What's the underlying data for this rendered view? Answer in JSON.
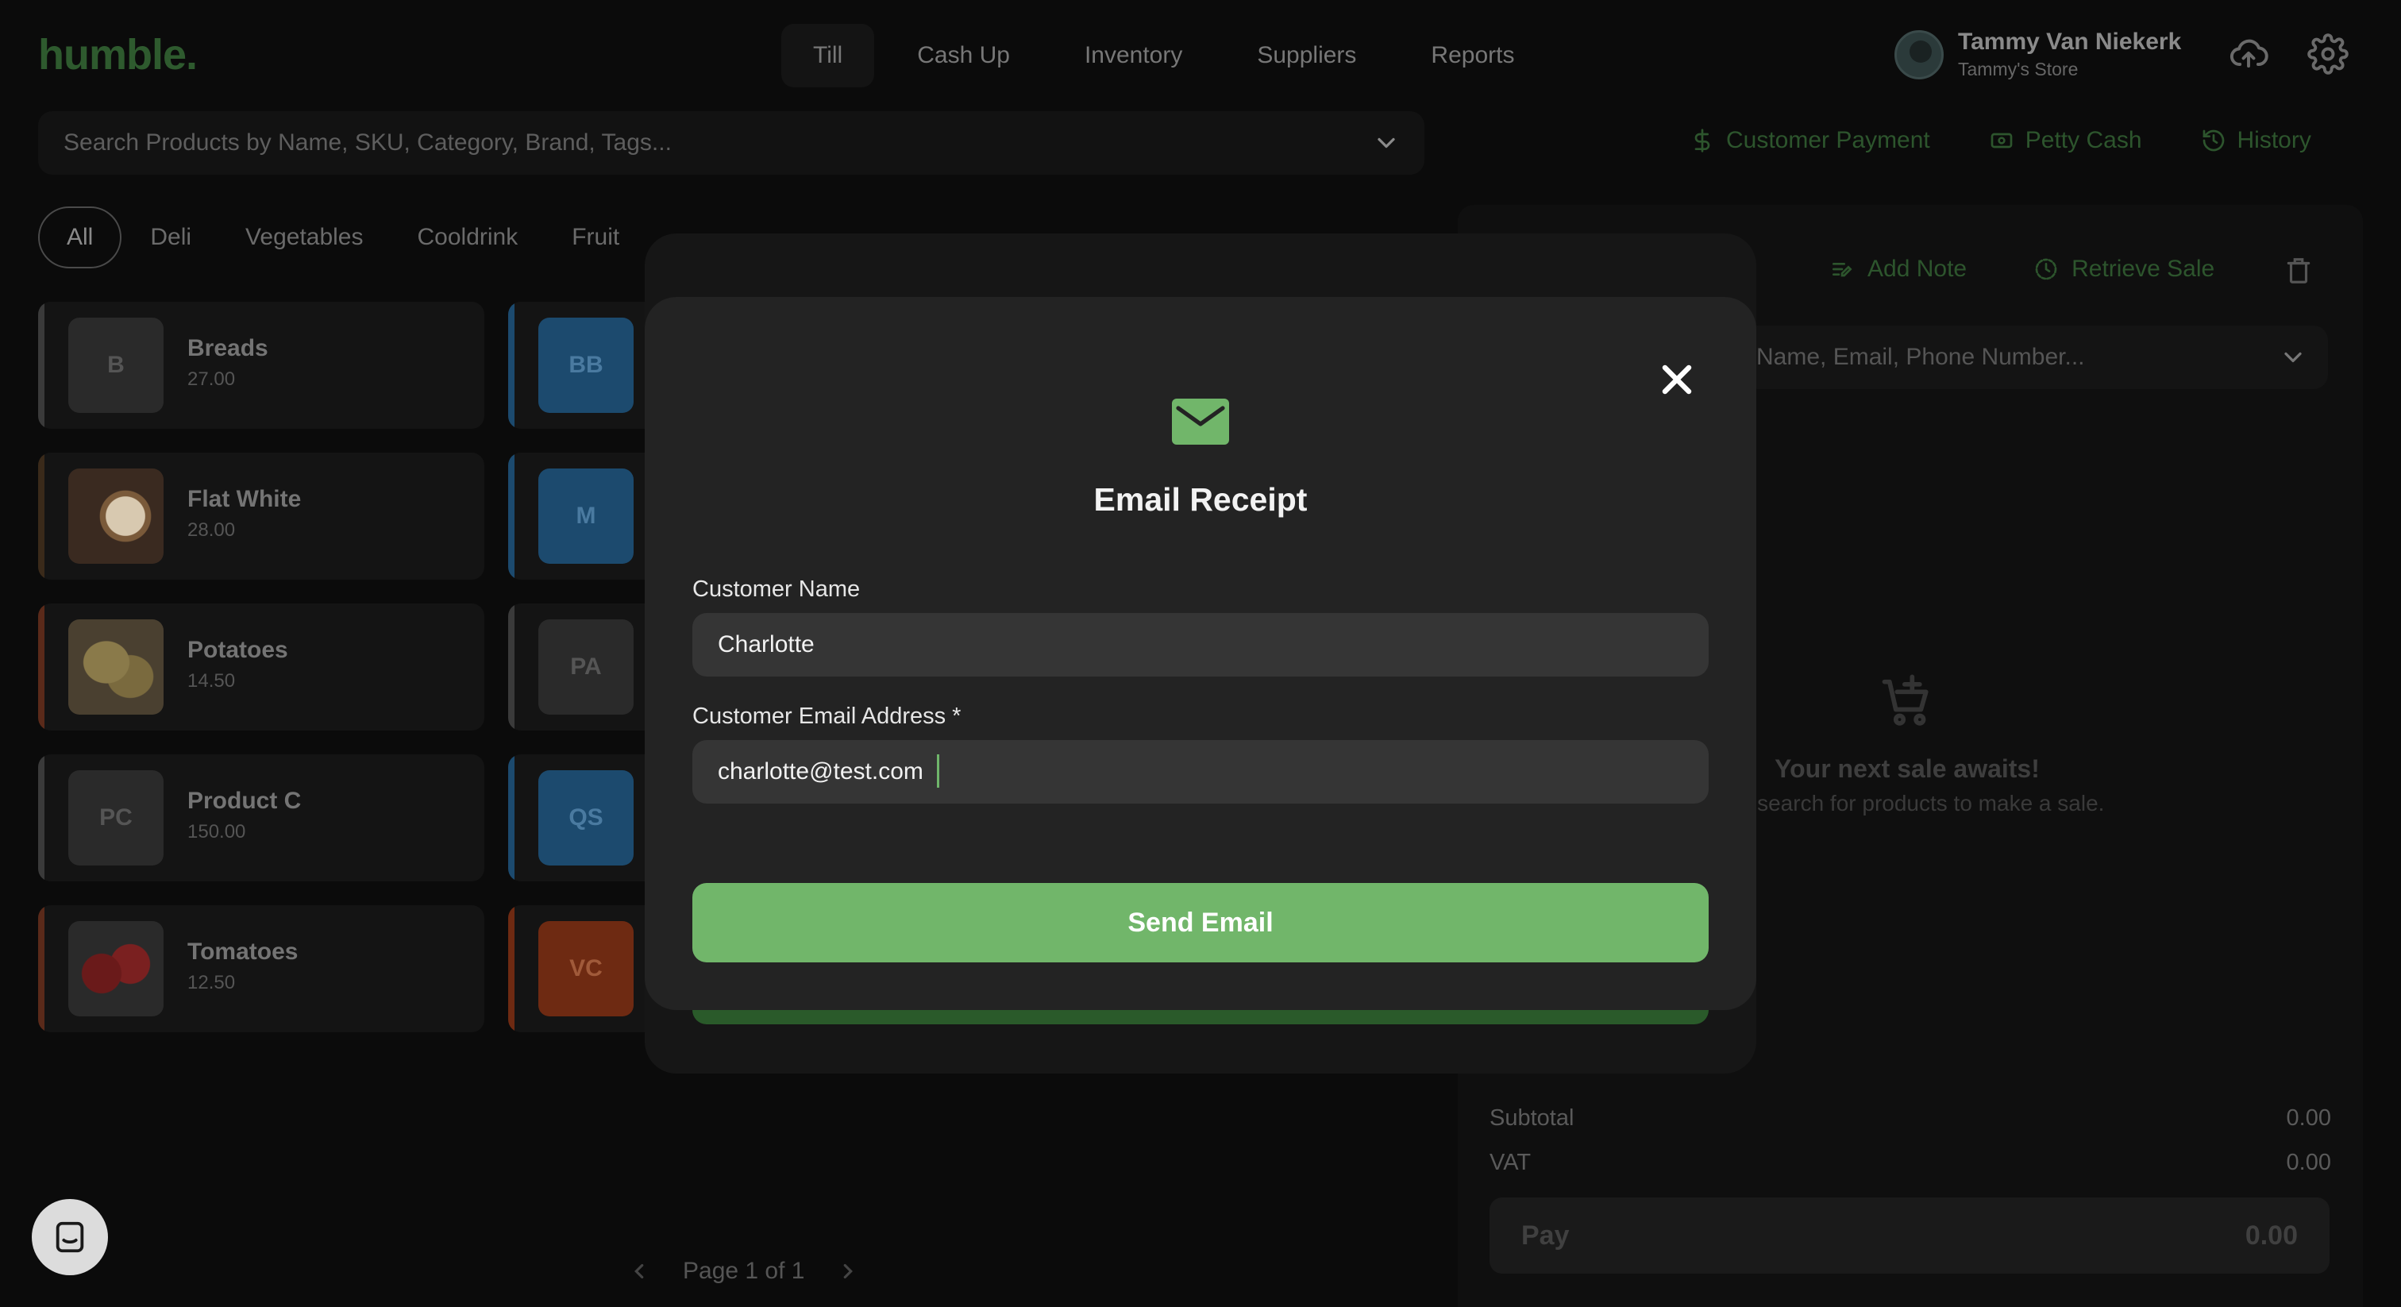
{
  "app": {
    "logo": "humble."
  },
  "nav": {
    "tabs": [
      "Till",
      "Cash Up",
      "Inventory",
      "Suppliers",
      "Reports"
    ],
    "active": "Till"
  },
  "user": {
    "name": "Tammy Van Niekerk",
    "store": "Tammy's Store"
  },
  "search": {
    "placeholder": "Search Products by Name, SKU, Category, Brand, Tags..."
  },
  "actions": {
    "customer_payment": "Customer Payment",
    "petty_cash": "Petty Cash",
    "history": "History"
  },
  "categories": [
    "All",
    "Deli",
    "Vegetables",
    "Cooldrink",
    "Fruit"
  ],
  "products": [
    {
      "initials": "B",
      "name": "Breads",
      "price": "27.00",
      "stripe": "#3a3a3a",
      "thumb": "#2a2a2a"
    },
    {
      "initials": "",
      "name": "Flat White",
      "price": "28.00",
      "stripe": "#3a2a1a",
      "thumb": "#5b4a3a"
    },
    {
      "initials": "",
      "name": "Potatoes",
      "price": "14.50",
      "stripe": "#5a2a1a",
      "thumb": "#6b5a3a"
    },
    {
      "initials": "PC",
      "name": "Product C",
      "price": "150.00",
      "stripe": "#3a3a3a",
      "thumb": "#2a2a2a"
    },
    {
      "initials": "",
      "name": "Tomatoes",
      "price": "12.50",
      "stripe": "#5a2a1a",
      "thumb": "#5a1a1a"
    }
  ],
  "products_col2": [
    {
      "initials": "BB",
      "stripe": "#1c4a6e",
      "thumb": "#1c4a6e"
    },
    {
      "initials": "M",
      "stripe": "#1c4a6e",
      "thumb": "#1c4a6e"
    },
    {
      "initials": "PA",
      "stripe": "#3a3a3a",
      "thumb": "#2a2a2a"
    },
    {
      "initials": "QS",
      "stripe": "#1c4a6e",
      "thumb": "#1c4a6e"
    },
    {
      "initials": "VC",
      "stripe": "#6e2a12",
      "thumb": "#6e2a12"
    }
  ],
  "cart": {
    "add_note": "Add Note",
    "retrieve_sale": "Retrieve Sale",
    "customer_placeholder": "Name, Email, Phone Number...",
    "empty_title": "Your next sale awaits!",
    "empty_sub": "r search for products to make a sale.",
    "subtotal_label": "Subtotal",
    "subtotal": "0.00",
    "vat_label": "VAT",
    "vat": "0.00",
    "pay_label": "Pay",
    "pay_total": "0.00"
  },
  "pager": {
    "label": "Page 1 of 1"
  },
  "modal": {
    "title": "Email Receipt",
    "name_label": "Customer Name",
    "name_value": "Charlotte",
    "email_label": "Customer Email Address *",
    "email_value": "charlotte@test.com",
    "send_label": "Send Email"
  },
  "colors": {
    "accent": "#71b66a",
    "modal_bg": "#232323",
    "field_bg": "#353535"
  }
}
